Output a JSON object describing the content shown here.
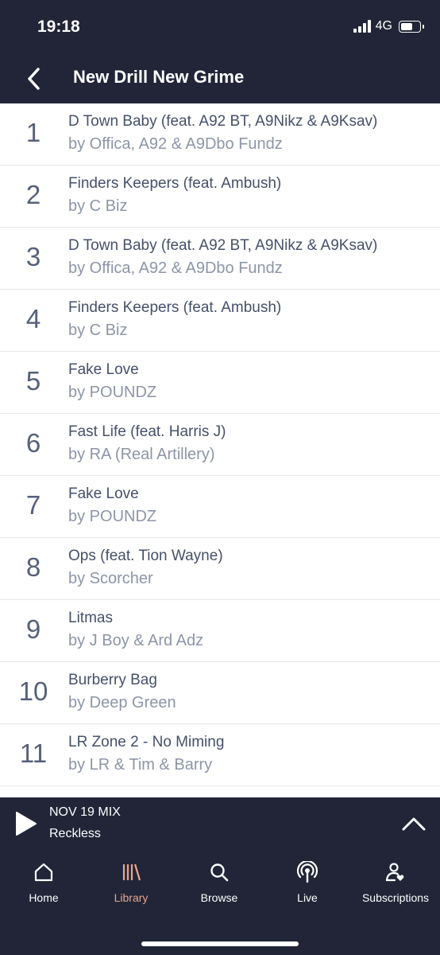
{
  "status_bar": {
    "time": "19:18",
    "network": "4G"
  },
  "header": {
    "title": "New Drill New Grime"
  },
  "tracks": [
    {
      "number": "1",
      "title": "D Town Baby (feat. A92 BT, A9Nikz & A9Ksav)",
      "artist": "by Offica, A92 & A9Dbo Fundz"
    },
    {
      "number": "2",
      "title": "Finders Keepers (feat. Ambush)",
      "artist": "by C Biz"
    },
    {
      "number": "3",
      "title": "D Town Baby (feat. A92 BT, A9Nikz & A9Ksav)",
      "artist": "by Offica, A92 & A9Dbo Fundz"
    },
    {
      "number": "4",
      "title": "Finders Keepers (feat. Ambush)",
      "artist": "by C Biz"
    },
    {
      "number": "5",
      "title": "Fake Love",
      "artist": "by POUNDZ"
    },
    {
      "number": "6",
      "title": "Fast Life (feat. Harris J)",
      "artist": "by RA (Real Artillery)"
    },
    {
      "number": "7",
      "title": "Fake Love",
      "artist": "by POUNDZ"
    },
    {
      "number": "8",
      "title": "Ops (feat. Tion Wayne)",
      "artist": "by Scorcher"
    },
    {
      "number": "9",
      "title": "Litmas",
      "artist": "by J Boy & Ard Adz"
    },
    {
      "number": "10",
      "title": "Burberry Bag",
      "artist": "by Deep Green"
    },
    {
      "number": "11",
      "title": "LR Zone 2 - No Miming",
      "artist": "by LR & Tim & Barry"
    }
  ],
  "player": {
    "show": "NOV 19 MIX",
    "track": "Reckless"
  },
  "tabs": [
    {
      "label": "Home",
      "icon": "home-icon"
    },
    {
      "label": "Library",
      "icon": "library-icon",
      "active": true
    },
    {
      "label": "Browse",
      "icon": "search-icon"
    },
    {
      "label": "Live",
      "icon": "live-broadcast-icon"
    },
    {
      "label": "Subscriptions",
      "icon": "subscriptions-icon"
    }
  ],
  "colors": {
    "bar_background": "#212537",
    "active_tab": "#e7a58f",
    "track_title": "#46506a",
    "track_artist": "#8d95a7"
  }
}
